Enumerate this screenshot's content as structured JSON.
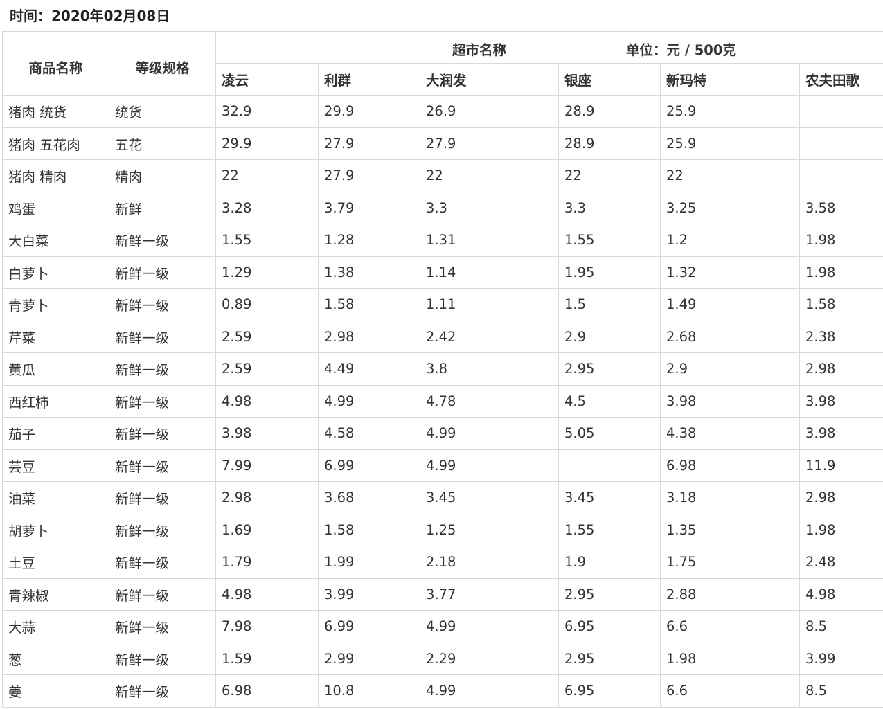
{
  "date_line": "时间：2020年02月08日",
  "headers": {
    "product": "商品名称",
    "grade": "等级规格",
    "supermarket": "超市名称",
    "unit": "单位：元 / 500克",
    "stores": [
      "凌云",
      "利群",
      "大润发",
      "银座",
      "新玛特",
      "农夫田歌"
    ]
  },
  "rows": [
    {
      "name": "猪肉 统货",
      "grade": "统货",
      "prices": [
        "32.9",
        "29.9",
        "26.9",
        "28.9",
        "25.9",
        ""
      ]
    },
    {
      "name": "猪肉 五花肉",
      "grade": "五花",
      "prices": [
        "29.9",
        "27.9",
        "27.9",
        "28.9",
        "25.9",
        ""
      ]
    },
    {
      "name": "猪肉 精肉",
      "grade": "精肉",
      "prices": [
        "22",
        "27.9",
        "22",
        "22",
        "22",
        ""
      ]
    },
    {
      "name": "鸡蛋",
      "grade": "新鲜",
      "prices": [
        "3.28",
        "3.79",
        "3.3",
        "3.3",
        "3.25",
        "3.58"
      ]
    },
    {
      "name": "大白菜",
      "grade": "新鲜一级",
      "prices": [
        "1.55",
        "1.28",
        "1.31",
        "1.55",
        "1.2",
        "1.98"
      ]
    },
    {
      "name": "白萝卜",
      "grade": "新鲜一级",
      "prices": [
        "1.29",
        "1.38",
        "1.14",
        "1.95",
        "1.32",
        "1.98"
      ]
    },
    {
      "name": "青萝卜",
      "grade": "新鲜一级",
      "prices": [
        "0.89",
        "1.58",
        "1.11",
        "1.5",
        "1.49",
        "1.58"
      ]
    },
    {
      "name": "芹菜",
      "grade": "新鲜一级",
      "prices": [
        "2.59",
        "2.98",
        "2.42",
        "2.9",
        "2.68",
        "2.38"
      ]
    },
    {
      "name": "黄瓜",
      "grade": "新鲜一级",
      "prices": [
        "2.59",
        "4.49",
        "3.8",
        "2.95",
        "2.9",
        "2.98"
      ]
    },
    {
      "name": "西红柿",
      "grade": "新鲜一级",
      "prices": [
        "4.98",
        "4.99",
        "4.78",
        "4.5",
        "3.98",
        "3.98"
      ]
    },
    {
      "name": "茄子",
      "grade": "新鲜一级",
      "prices": [
        "3.98",
        "4.58",
        "4.99",
        "5.05",
        "4.38",
        "3.98"
      ]
    },
    {
      "name": "芸豆",
      "grade": "新鲜一级",
      "prices": [
        "7.99",
        "6.99",
        "4.99",
        "",
        "6.98",
        "11.9"
      ]
    },
    {
      "name": "油菜",
      "grade": "新鲜一级",
      "prices": [
        "2.98",
        "3.68",
        "3.45",
        "3.45",
        "3.18",
        "2.98"
      ]
    },
    {
      "name": "胡萝卜",
      "grade": "新鲜一级",
      "prices": [
        "1.69",
        "1.58",
        "1.25",
        "1.55",
        "1.35",
        "1.98"
      ]
    },
    {
      "name": "土豆",
      "grade": "新鲜一级",
      "prices": [
        "1.79",
        "1.99",
        "2.18",
        "1.9",
        "1.75",
        "2.48"
      ]
    },
    {
      "name": "青辣椒",
      "grade": "新鲜一级",
      "prices": [
        "4.98",
        "3.99",
        "3.77",
        "2.95",
        "2.88",
        "4.98"
      ]
    },
    {
      "name": "大蒜",
      "grade": "新鲜一级",
      "prices": [
        "7.98",
        "6.99",
        "4.99",
        "6.95",
        "6.6",
        "8.5"
      ]
    },
    {
      "name": "葱",
      "grade": "新鲜一级",
      "prices": [
        "1.59",
        "2.99",
        "2.29",
        "2.95",
        "1.98",
        "3.99"
      ]
    },
    {
      "name": "姜",
      "grade": "新鲜一级",
      "prices": [
        "6.98",
        "10.8",
        "4.99",
        "6.95",
        "6.6",
        "8.5"
      ]
    }
  ]
}
